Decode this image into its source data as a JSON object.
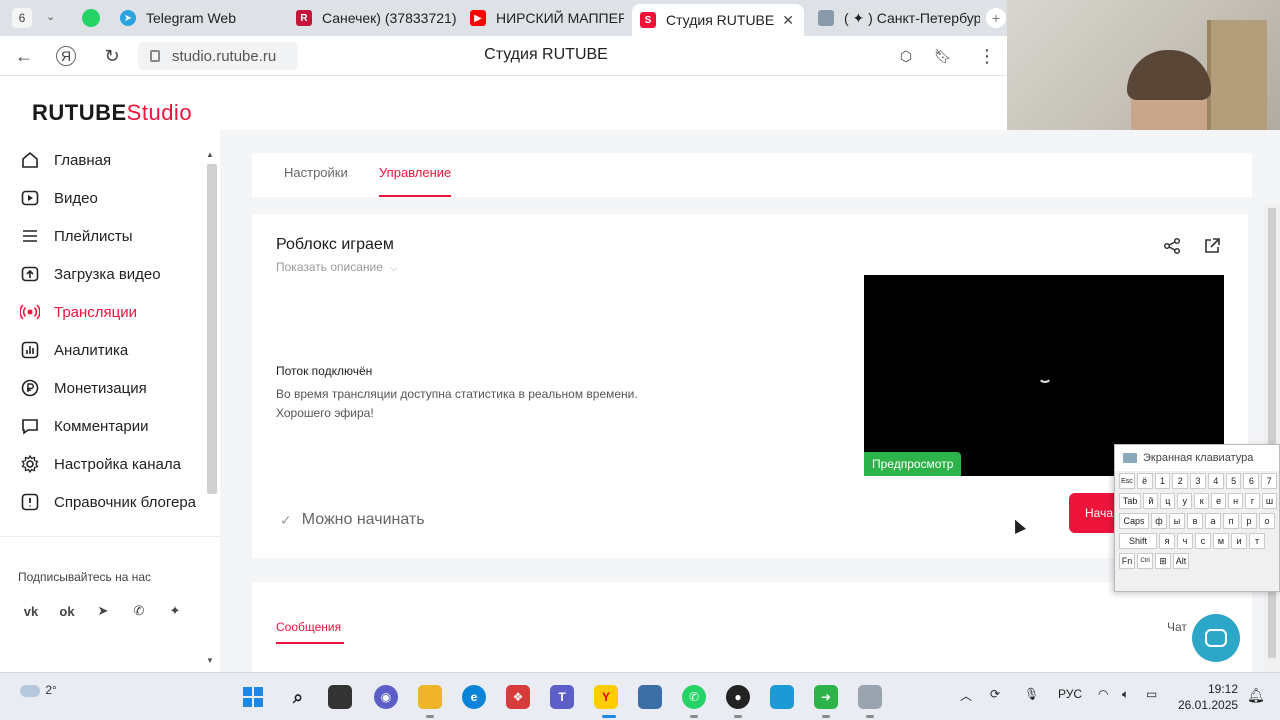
{
  "browser": {
    "tab_count": "6",
    "tabs": [
      {
        "label": "Telegram Web",
        "color": "#2aa3df"
      },
      {
        "label": "Санечек) (37833721)",
        "color": "#c4163a"
      },
      {
        "label": "НИРСКИЙ МАППЕР",
        "color": "#ff0000"
      },
      {
        "label": "Студия RUTUBE",
        "color": "#ed143b"
      },
      {
        "label": "( ✦ ) Санкт-Петербур",
        "color": "#8899aa"
      }
    ],
    "new_tab_symbol": "+",
    "close_symbol": "✕",
    "url": "studio.rutube.ru",
    "page_title": "Студия RUTUBE",
    "downloads_count": "3"
  },
  "logo": {
    "brand": "RUTUBE",
    "suffix": "Studio"
  },
  "sidebar": {
    "items": [
      {
        "label": "Главная",
        "icon": "home-icon"
      },
      {
        "label": "Видео",
        "icon": "video-icon"
      },
      {
        "label": "Плейлисты",
        "icon": "playlist-icon"
      },
      {
        "label": "Загрузка видео",
        "icon": "upload-icon"
      },
      {
        "label": "Трансляции",
        "icon": "broadcast-icon",
        "active": true
      },
      {
        "label": "Аналитика",
        "icon": "analytics-icon"
      },
      {
        "label": "Монетизация",
        "icon": "ruble-icon"
      },
      {
        "label": "Комментарии",
        "icon": "comment-icon"
      },
      {
        "label": "Настройка канала",
        "icon": "gear-icon"
      },
      {
        "label": "Справочник блогера",
        "icon": "help-icon"
      }
    ],
    "subscribe_label": "Подписывайтесь на нас",
    "social": [
      "vk-icon",
      "ok-icon",
      "telegram-icon",
      "viber-icon",
      "dzen-icon"
    ]
  },
  "main": {
    "tabs": [
      {
        "label": "Настройки"
      },
      {
        "label": "Управление",
        "active": true
      }
    ],
    "stream": {
      "title": "Роблокс играем",
      "show_description": "Показать описание",
      "status_title": "Поток подключён",
      "status_line1": "Во время трансляции доступна статистика в реальном времени.",
      "status_line2": "Хорошего эфира!",
      "preview_badge": "Предпросмотр",
      "ready_label": "Можно начинать",
      "start_button": "Нача"
    },
    "messages_tab": "Сообщения",
    "chat_label": "Чат"
  },
  "keyboard": {
    "title": "Экранная клавиатура",
    "rows": [
      [
        "Esc",
        "ё",
        "1",
        "2",
        "3",
        "4",
        "5",
        "6",
        "7"
      ],
      [
        "Tab",
        "й",
        "ц",
        "у",
        "к",
        "е",
        "н",
        "г",
        "ш"
      ],
      [
        "Caps",
        "ф",
        "ы",
        "в",
        "а",
        "п",
        "р",
        "о"
      ],
      [
        "Shift",
        "я",
        "ч",
        "с",
        "м",
        "и",
        "т",
        "ь"
      ],
      [
        "Fn",
        "Ctrl",
        "⊞",
        "Alt"
      ]
    ]
  },
  "taskbar": {
    "weather": "2°",
    "language": "РУС",
    "time": "19:12",
    "date": "26.01.2025"
  },
  "colors": {
    "accent": "#ed143b",
    "preview_badge": "#2cb34a",
    "help_fab": "#2da7c7"
  }
}
